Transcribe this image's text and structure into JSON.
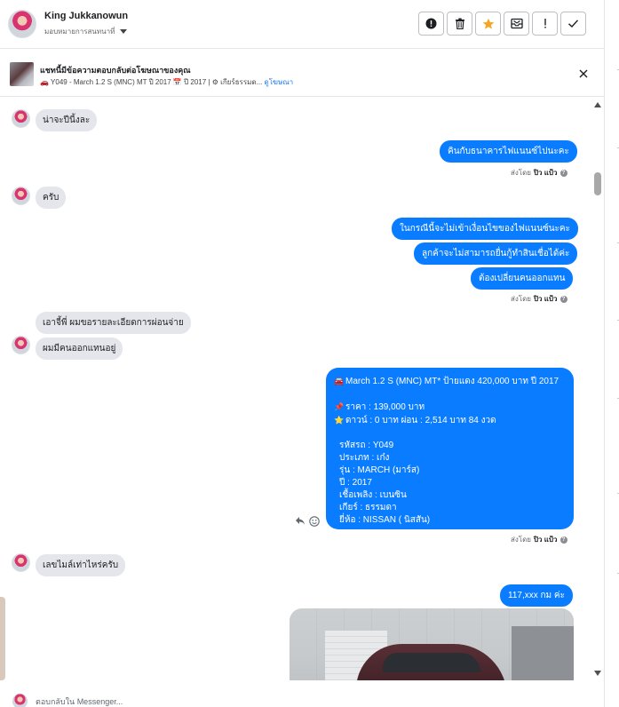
{
  "header": {
    "user_name": "King Jukkanowun",
    "assign_label": "มอบหมายการสนทนาที่",
    "toolbar": [
      {
        "name": "report-spam-button",
        "icon": "alert-circle-icon"
      },
      {
        "name": "delete-button",
        "icon": "trash-icon"
      },
      {
        "name": "star-button",
        "icon": "star-icon",
        "active_color": "#f5a623"
      },
      {
        "name": "move-to-inbox-button",
        "icon": "inbox-icon"
      },
      {
        "name": "mark-follow-up-button",
        "icon": "exclamation-icon"
      },
      {
        "name": "mark-done-button",
        "icon": "check-icon"
      }
    ]
  },
  "ad_banner": {
    "title": "แชทนี้มีข้อความตอบกลับต่อโฆษณาของคุณ",
    "details": "🚗 Y049 - March 1.2 S (MNC) MT ปี 2017 📅 ปี 2017 | ⚙ เกียร์ธรรมด...",
    "view_ad_link": "ดูโฆษณา"
  },
  "messages": {
    "m1": "น่าจะปีนี้งละ",
    "m2": "คินกับธนาคารไฟแนนซ์ไปนะคะ",
    "m3": "ครับ",
    "m4": "ในกรณีนี้จะไม่เข้าเงื่อนไขของไฟแนนซ์นะคะ",
    "m5": "ลูกค้าจะไม่สามารถยื่นกู้ทำสินเชื่อได้ค่ะ",
    "m6": "ต้องเปลี่ยนคนออกแทน",
    "m7": "เอาจี้พี่ ผมขอรายละเอียดการผ่อนจ่าย",
    "m8": "ผมมีคนออกแทนอยู่",
    "m9": "เลขไมล์เท่าไหร่ครับ",
    "m10": "117,xxx กม ค่ะ"
  },
  "car_listing": {
    "headline": "March 1.2 S (MNC) MT* ป้ายแดง 420,000 บาท ปี 2017",
    "price": "ราคา : 139,000 บาท",
    "payment": "ดาวน์ : 0 บาท ผ่อน : 2,514 บาท 84 งวด",
    "car_code": "รหัสรถ : Y049",
    "type": "ประเภท : เก๋ง",
    "model": "รุ่น : MARCH (มาร์ส)",
    "year": "ปี : 2017",
    "fuel": "เชื้อเพลิง : เบนซิน",
    "gear": "เกียร์ : ธรรมดา",
    "brand": "ยี่ห้อ : NISSAN ( นิสสัน)"
  },
  "sent_by": {
    "prefix": "ส่งโดย",
    "name": "ปิว แป้ว"
  },
  "composer": {
    "placeholder": "ตอบกลับใน Messenger..."
  },
  "colors": {
    "outgoing_bubble": "#0a7cff",
    "incoming_bubble": "#e4e6eb",
    "link": "#1877f2"
  }
}
